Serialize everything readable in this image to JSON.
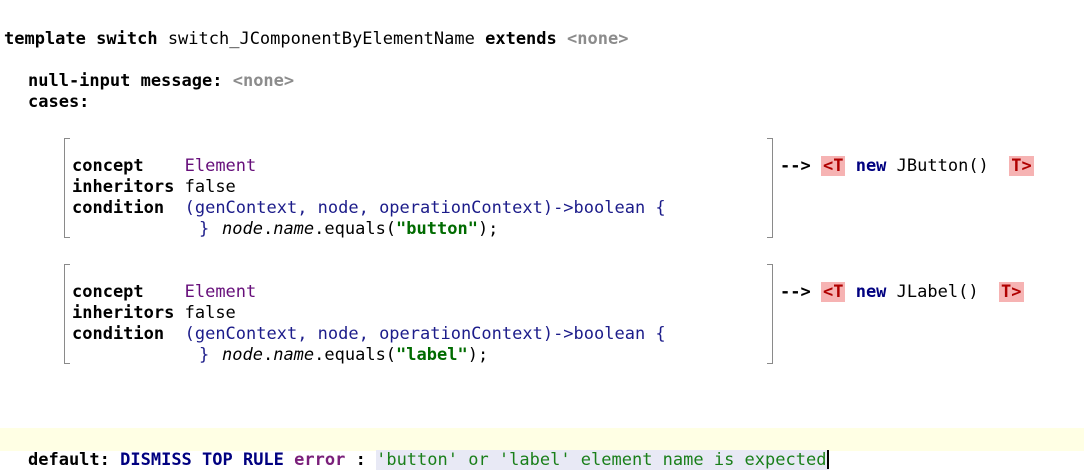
{
  "header": {
    "template_kw": "template",
    "switch_kw": "switch",
    "name": "switch_JComponentByElementName",
    "extends_kw": "extends",
    "extends_value": "<none>"
  },
  "null_input": {
    "label": "null-input message:",
    "value": "<none>"
  },
  "cases_label": "cases:",
  "cases": [
    {
      "concept_kw": "concept",
      "concept_value": "Element",
      "inheritors_kw": "inheritors",
      "inheritors_value": "false",
      "condition_kw": "condition",
      "condition_signature": "(genContext, node, operationContext)->boolean {",
      "body_node": "node",
      "body_dot1": ".",
      "body_name": "name",
      "body_equals": ".equals(",
      "body_string": "\"button\"",
      "body_end": ");",
      "close_brace": "}",
      "arrow": "-->",
      "tag_open": "<T",
      "new_kw": "new",
      "constructor": "JButton()",
      "tag_close": "T>"
    },
    {
      "concept_kw": "concept",
      "concept_value": "Element",
      "inheritors_kw": "inheritors",
      "inheritors_value": "false",
      "condition_kw": "condition",
      "condition_signature": "(genContext, node, operationContext)->boolean {",
      "body_node": "node",
      "body_dot1": ".",
      "body_name": "name",
      "body_equals": ".equals(",
      "body_string": "\"label\"",
      "body_end": ");",
      "close_brace": "}",
      "arrow": "-->",
      "tag_open": "<T",
      "new_kw": "new",
      "constructor": "JLabel()",
      "tag_close": "T>"
    }
  ],
  "default": {
    "label": "default:",
    "action": "DISMISS TOP RULE",
    "error_kw": "error",
    "colon": ":",
    "message": "'button' or 'label' element name is expected"
  },
  "colors": {
    "tag_bg": "#f6b3b3",
    "concept": "#660e7a",
    "string": "#006b00",
    "default_bar": "#ffffe4",
    "message_bg": "#e8e9f5"
  }
}
